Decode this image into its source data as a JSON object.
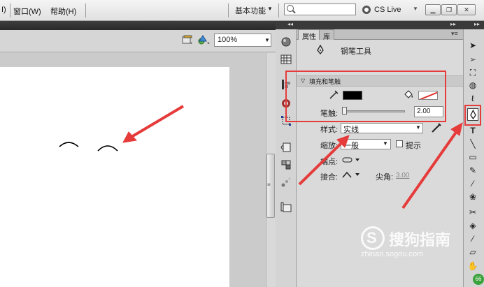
{
  "menubar": {
    "items": [
      "窗口(W)",
      "帮助(H)"
    ],
    "partial_item": "I)",
    "workspace": "基本功能",
    "search_placeholder": "",
    "cs_live": "CS Live"
  },
  "stage": {
    "zoom": "100%"
  },
  "panel": {
    "tabs": [
      "属性",
      "库"
    ],
    "tool_name": "钢笔工具",
    "section_title": "填充和笔触",
    "stroke_label": "笔触:",
    "stroke_value": "2.00",
    "style_label": "样式:",
    "style_value": "实线",
    "scale_label": "缩放:",
    "scale_value": "一般",
    "hint_label": "提示",
    "cap_label": "端点:",
    "join_label": "接合:",
    "miter_label": "尖角:",
    "miter_value": "3.00"
  },
  "colors": {
    "highlight": "#e53b3b",
    "stroke_color": "#000000"
  },
  "tools": [
    "selection-icon",
    "subselection-icon",
    "free-transform-icon",
    "3d-rotation-icon",
    "lasso-icon",
    "pen-icon",
    "text-icon",
    "line-icon",
    "rectangle-icon",
    "pencil-icon",
    "brush-icon",
    "deco-icon",
    "bone-icon",
    "paint-bucket-icon",
    "eyedropper-icon",
    "eraser-icon",
    "hand-icon"
  ],
  "watermark": {
    "text": "搜狗指南",
    "url": "zhinan.sogou.com"
  }
}
